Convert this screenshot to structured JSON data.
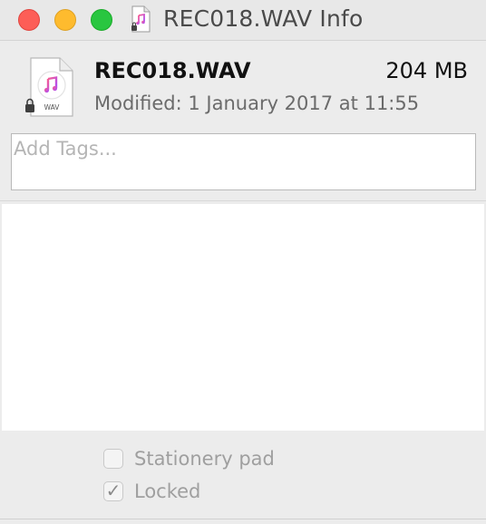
{
  "window": {
    "title": "REC018.WAV Info"
  },
  "file": {
    "name": "REC018.WAV",
    "size": "204 MB",
    "modified": "Modified: 1 January 2017 at 11:55",
    "icon_label": "WAV",
    "icon": "music-note-document-icon"
  },
  "tags": {
    "placeholder": "Add Tags..."
  },
  "options": {
    "stationery_label": "Stationery pad",
    "stationery_checked": false,
    "locked_label": "Locked",
    "locked_checked": true,
    "check_glyph": "✓"
  },
  "colors": {
    "close": "#fd5e57",
    "minimize": "#febb2e",
    "maximize": "#29c640",
    "note_gradient_start": "#fa5c8f",
    "note_gradient_end": "#a64dff"
  }
}
